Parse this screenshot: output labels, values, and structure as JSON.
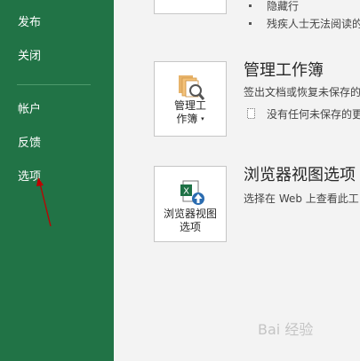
{
  "sidebar": {
    "items": [
      {
        "label": "发布"
      },
      {
        "label": "关闭"
      },
      {
        "label": "帐户"
      },
      {
        "label": "反馈"
      },
      {
        "label": "选项"
      }
    ]
  },
  "top_bullets": [
    {
      "text": "隐藏行"
    },
    {
      "text": "残疾人士无法阅读的"
    }
  ],
  "manage_workbook": {
    "tile_label_line1": "管理工",
    "tile_label_line2": "作簿",
    "title": "管理工作簿",
    "desc": "签出文档或恢复未保存的",
    "status": "没有任何未保存的更"
  },
  "browser_view": {
    "tile_label_line1": "浏览器视图",
    "tile_label_line2": "选项",
    "title": "浏览器视图选项",
    "desc": "选择在 Web 上查看此工"
  },
  "watermark": "Bai 经验",
  "colors": {
    "sidebar": "#217346",
    "arrow": "#c00000",
    "excel_green": "#1e7145",
    "accent_blue": "#2b6cb0"
  }
}
